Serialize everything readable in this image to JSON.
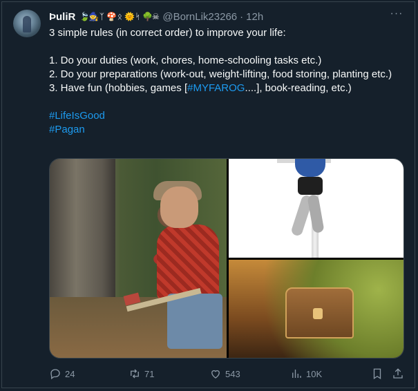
{
  "tweet": {
    "author_name": "ÞuliR",
    "author_emojis": [
      "🍃",
      "🧙",
      "ᛉ",
      "🍄",
      "ᛟ",
      "🌞",
      "ᛋ",
      "🌳",
      "☠"
    ],
    "handle": "@BornLik23266",
    "separator": "·",
    "time": "12h",
    "more_label": "···",
    "line1": "3 simple rules (in correct order) to improve your life:",
    "rule1": "1. Do your duties (work, chores, home-schooling tasks etc.)",
    "rule2": "2. Do your preparations (work-out, weight-lifting, food storing, planting etc.)",
    "rule3_pre": "3. Have fun (hobbies, games [",
    "rule3_link": "#MYFAROG",
    "rule3_post": "....], book-reading, etc.)",
    "hashtag1": "#LifeIsGood",
    "hashtag2": "#Pagan"
  },
  "actions": {
    "replies": "24",
    "retweets": "71",
    "likes": "543",
    "views": "10K"
  },
  "colors": {
    "background": "#15202b",
    "text": "#f7f9f9",
    "secondary": "#8b98a5",
    "link": "#1d9bf0",
    "border": "#38444d"
  },
  "icons": [
    "more-icon",
    "reply-icon",
    "retweet-icon",
    "like-icon",
    "views-icon",
    "bookmark-icon",
    "share-icon"
  ]
}
